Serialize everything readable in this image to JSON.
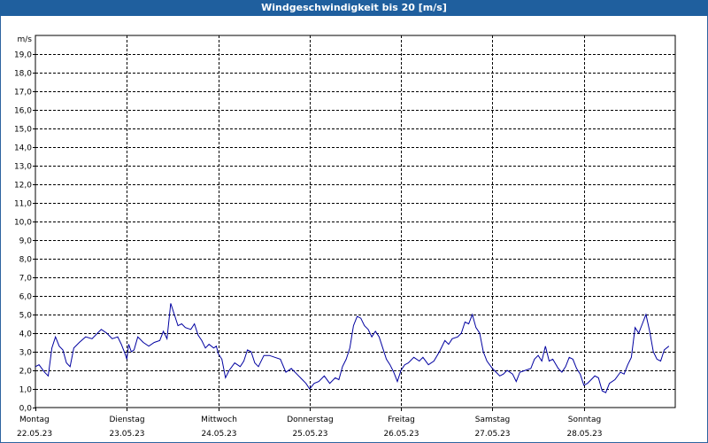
{
  "title": "Windgeschwindigkeit bis 20 [m/s]",
  "colors": {
    "titlebar": "#1f5f9e",
    "line": "#0000a0",
    "grid": "#000000"
  },
  "chart_data": {
    "type": "line",
    "title": "Windgeschwindigkeit bis 20 [m/s]",
    "ylabel": "m/s",
    "ylim": [
      0,
      20
    ],
    "yticks": [
      "0,0",
      "1,0",
      "2,0",
      "3,0",
      "4,0",
      "5,0",
      "6,0",
      "7,0",
      "8,0",
      "9,0",
      "10,0",
      "11,0",
      "12,0",
      "13,0",
      "14,0",
      "15,0",
      "16,0",
      "17,0",
      "18,0",
      "19,0"
    ],
    "grid": true,
    "x_days": [
      {
        "day": "Montag",
        "date": "22.05.23"
      },
      {
        "day": "Dienstag",
        "date": "23.05.23"
      },
      {
        "day": "Mittwoch",
        "date": "24.05.23"
      },
      {
        "day": "Donnerstag",
        "date": "25.05.23"
      },
      {
        "day": "Freitag",
        "date": "26.05.23"
      },
      {
        "day": "Samstag",
        "date": "27.05.23"
      },
      {
        "day": "Sonntag",
        "date": "28.05.23"
      }
    ],
    "x_unit": "days",
    "xlim": [
      0,
      7
    ],
    "series": [
      {
        "values": [
          [
            0.0,
            2.2
          ],
          [
            0.04,
            2.3
          ],
          [
            0.1,
            1.9
          ],
          [
            0.14,
            1.7
          ],
          [
            0.18,
            3.2
          ],
          [
            0.22,
            3.8
          ],
          [
            0.26,
            3.3
          ],
          [
            0.3,
            3.1
          ],
          [
            0.34,
            2.4
          ],
          [
            0.38,
            2.2
          ],
          [
            0.42,
            3.2
          ],
          [
            0.48,
            3.5
          ],
          [
            0.55,
            3.8
          ],
          [
            0.62,
            3.7
          ],
          [
            0.68,
            4.0
          ],
          [
            0.72,
            4.2
          ],
          [
            0.78,
            4.0
          ],
          [
            0.84,
            3.7
          ],
          [
            0.9,
            3.8
          ],
          [
            0.94,
            3.4
          ],
          [
            0.98,
            2.9
          ],
          [
            1.0,
            2.6
          ],
          [
            1.02,
            3.4
          ],
          [
            1.05,
            3.0
          ],
          [
            1.08,
            3.1
          ],
          [
            1.12,
            3.8
          ],
          [
            1.18,
            3.5
          ],
          [
            1.24,
            3.3
          ],
          [
            1.3,
            3.5
          ],
          [
            1.36,
            3.6
          ],
          [
            1.4,
            4.1
          ],
          [
            1.44,
            3.7
          ],
          [
            1.48,
            5.6
          ],
          [
            1.52,
            5.0
          ],
          [
            1.56,
            4.4
          ],
          [
            1.6,
            4.5
          ],
          [
            1.64,
            4.3
          ],
          [
            1.7,
            4.2
          ],
          [
            1.74,
            4.5
          ],
          [
            1.78,
            3.9
          ],
          [
            1.82,
            3.6
          ],
          [
            1.86,
            3.2
          ],
          [
            1.9,
            3.4
          ],
          [
            1.95,
            3.2
          ],
          [
            1.98,
            3.3
          ],
          [
            2.0,
            2.9
          ],
          [
            2.04,
            2.6
          ],
          [
            2.08,
            1.6
          ],
          [
            2.12,
            2.0
          ],
          [
            2.18,
            2.4
          ],
          [
            2.24,
            2.2
          ],
          [
            2.28,
            2.5
          ],
          [
            2.32,
            3.1
          ],
          [
            2.36,
            3.0
          ],
          [
            2.4,
            2.4
          ],
          [
            2.44,
            2.2
          ],
          [
            2.5,
            2.8
          ],
          [
            2.56,
            2.8
          ],
          [
            2.62,
            2.7
          ],
          [
            2.68,
            2.6
          ],
          [
            2.74,
            1.9
          ],
          [
            2.8,
            2.1
          ],
          [
            2.86,
            1.8
          ],
          [
            2.92,
            1.5
          ],
          [
            2.96,
            1.3
          ],
          [
            3.0,
            1.0
          ],
          [
            3.05,
            1.3
          ],
          [
            3.1,
            1.4
          ],
          [
            3.16,
            1.7
          ],
          [
            3.22,
            1.3
          ],
          [
            3.28,
            1.6
          ],
          [
            3.32,
            1.5
          ],
          [
            3.36,
            2.2
          ],
          [
            3.4,
            2.6
          ],
          [
            3.44,
            3.2
          ],
          [
            3.48,
            4.4
          ],
          [
            3.52,
            4.9
          ],
          [
            3.56,
            4.8
          ],
          [
            3.6,
            4.4
          ],
          [
            3.64,
            4.2
          ],
          [
            3.68,
            3.8
          ],
          [
            3.72,
            4.1
          ],
          [
            3.76,
            3.8
          ],
          [
            3.8,
            3.2
          ],
          [
            3.84,
            2.6
          ],
          [
            3.88,
            2.3
          ],
          [
            3.92,
            1.9
          ],
          [
            3.96,
            1.4
          ],
          [
            4.0,
            2.0
          ],
          [
            4.04,
            2.3
          ],
          [
            4.08,
            2.4
          ],
          [
            4.14,
            2.7
          ],
          [
            4.2,
            2.5
          ],
          [
            4.24,
            2.7
          ],
          [
            4.3,
            2.3
          ],
          [
            4.36,
            2.5
          ],
          [
            4.42,
            3.0
          ],
          [
            4.48,
            3.6
          ],
          [
            4.52,
            3.4
          ],
          [
            4.56,
            3.7
          ],
          [
            4.62,
            3.8
          ],
          [
            4.66,
            4.0
          ],
          [
            4.7,
            4.6
          ],
          [
            4.74,
            4.5
          ],
          [
            4.78,
            5.0
          ],
          [
            4.82,
            4.3
          ],
          [
            4.86,
            4.0
          ],
          [
            4.9,
            3.0
          ],
          [
            4.94,
            2.5
          ],
          [
            5.0,
            2.1
          ],
          [
            5.04,
            1.9
          ],
          [
            5.08,
            1.7
          ],
          [
            5.12,
            1.8
          ],
          [
            5.16,
            2.0
          ],
          [
            5.22,
            1.8
          ],
          [
            5.26,
            1.4
          ],
          [
            5.3,
            1.9
          ],
          [
            5.36,
            2.0
          ],
          [
            5.42,
            2.1
          ],
          [
            5.46,
            2.6
          ],
          [
            5.5,
            2.8
          ],
          [
            5.54,
            2.5
          ],
          [
            5.58,
            3.3
          ],
          [
            5.62,
            2.5
          ],
          [
            5.66,
            2.6
          ],
          [
            5.72,
            2.1
          ],
          [
            5.76,
            1.9
          ],
          [
            5.8,
            2.2
          ],
          [
            5.84,
            2.7
          ],
          [
            5.88,
            2.6
          ],
          [
            5.92,
            2.1
          ],
          [
            5.96,
            1.8
          ],
          [
            6.0,
            1.2
          ],
          [
            6.04,
            1.3
          ],
          [
            6.08,
            1.5
          ],
          [
            6.12,
            1.7
          ],
          [
            6.16,
            1.6
          ],
          [
            6.2,
            0.9
          ],
          [
            6.24,
            0.8
          ],
          [
            6.28,
            1.3
          ],
          [
            6.34,
            1.5
          ],
          [
            6.4,
            1.9
          ],
          [
            6.44,
            1.8
          ],
          [
            6.48,
            2.3
          ],
          [
            6.52,
            2.7
          ],
          [
            6.56,
            4.3
          ],
          [
            6.6,
            4.0
          ],
          [
            6.64,
            4.5
          ],
          [
            6.68,
            5.0
          ],
          [
            6.72,
            4.1
          ],
          [
            6.76,
            3.0
          ],
          [
            6.8,
            2.6
          ],
          [
            6.84,
            2.5
          ],
          [
            6.88,
            3.1
          ],
          [
            6.93,
            3.3
          ]
        ]
      }
    ]
  }
}
